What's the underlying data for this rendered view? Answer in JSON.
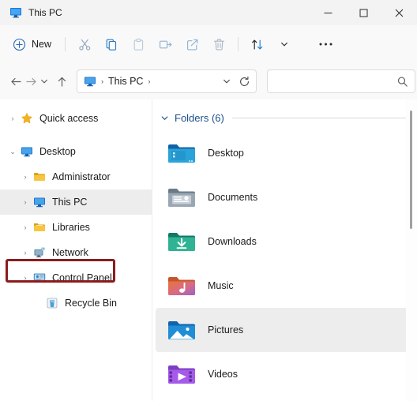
{
  "window": {
    "title": "This PC",
    "title_icon": "this-pc-monitor-icon",
    "controls": {
      "minimize": "—",
      "maximize": "□",
      "close": "✕"
    }
  },
  "toolbar": {
    "new_label": "New",
    "buttons": [
      {
        "name": "new-button",
        "label": "New",
        "icon": "plus-circle-icon"
      },
      {
        "name": "cut-button",
        "label": "Cut",
        "icon": "scissors-icon"
      },
      {
        "name": "copy-button",
        "label": "Copy",
        "icon": "copy-icon"
      },
      {
        "name": "paste-button",
        "label": "Paste",
        "icon": "clipboard-icon"
      },
      {
        "name": "rename-button",
        "label": "Rename",
        "icon": "rename-icon"
      },
      {
        "name": "share-button",
        "label": "Share",
        "icon": "share-icon"
      },
      {
        "name": "delete-button",
        "label": "Delete",
        "icon": "trash-icon"
      },
      {
        "name": "sort-button",
        "label": "Sort",
        "icon": "sort-arrows-icon"
      },
      {
        "name": "sort-dropdown",
        "label": "",
        "icon": "chevron-down-icon"
      },
      {
        "name": "more-options-button",
        "label": "See more",
        "icon": "ellipsis-icon"
      }
    ]
  },
  "navigation": {
    "back": "←",
    "forward": "→",
    "recent_chevron": "⌄",
    "up": "↑",
    "refresh": "↻",
    "address_chevron": "⌄"
  },
  "address": {
    "icon": "this-pc-monitor-icon",
    "separator": "›",
    "crumb": "This PC",
    "trailing_separator": "›"
  },
  "search": {
    "value": "",
    "placeholder": "",
    "icon": "search-icon"
  },
  "sidebar": {
    "items": [
      {
        "label": "Quick access",
        "icon": "star-icon",
        "indent": 0,
        "chevron": "›",
        "expanded": false,
        "selected": false
      },
      {
        "label": "Desktop",
        "icon": "monitor-icon",
        "indent": 0,
        "chevron": "⌄",
        "expanded": true,
        "selected": false
      },
      {
        "label": "Administrator",
        "icon": "folder-yellow-icon",
        "indent": 1,
        "chevron": "›",
        "expanded": false,
        "selected": false
      },
      {
        "label": "This PC",
        "icon": "monitor-icon",
        "indent": 1,
        "chevron": "›",
        "expanded": false,
        "selected": true
      },
      {
        "label": "Libraries",
        "icon": "folder-yellow-icon",
        "indent": 1,
        "chevron": "›",
        "expanded": false,
        "selected": false
      },
      {
        "label": "Network",
        "icon": "network-icon",
        "indent": 1,
        "chevron": "›",
        "expanded": false,
        "selected": false
      },
      {
        "label": "Control Panel",
        "icon": "control-panel-icon",
        "indent": 1,
        "chevron": "›",
        "expanded": false,
        "selected": false
      },
      {
        "label": "Recycle Bin",
        "icon": "recycle-bin-icon",
        "indent": 2,
        "chevron": "",
        "expanded": false,
        "selected": false
      }
    ]
  },
  "annotation": {
    "target": "Control Panel",
    "color": "#8c1c1c",
    "shape": "rectangle"
  },
  "content": {
    "group_header": "Folders (6)",
    "group_chevron": "⌄",
    "folders": [
      {
        "label": "Desktop",
        "icon": "folder-desktop-icon",
        "hover": false
      },
      {
        "label": "Documents",
        "icon": "folder-documents-icon",
        "hover": false
      },
      {
        "label": "Downloads",
        "icon": "folder-downloads-icon",
        "hover": false
      },
      {
        "label": "Music",
        "icon": "folder-music-icon",
        "hover": false
      },
      {
        "label": "Pictures",
        "icon": "folder-pictures-icon",
        "hover": true
      },
      {
        "label": "Videos",
        "icon": "folder-videos-icon",
        "hover": false
      }
    ]
  },
  "scrollbar": {
    "name": "vertical-scrollbar"
  },
  "colors": {
    "accent_blue": "#0067c0",
    "header_blue": "#1b4f8a",
    "annotation_red": "#8c1c1c",
    "selection_gray": "#ededed"
  }
}
